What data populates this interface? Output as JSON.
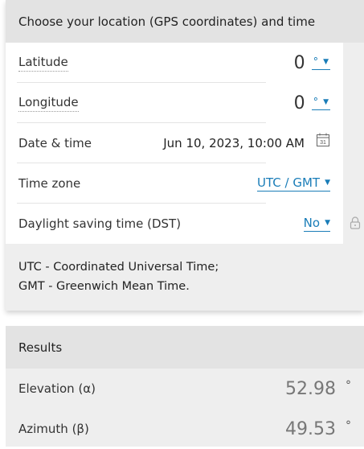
{
  "location": {
    "title": "Choose your location (GPS coordinates) and time",
    "latitude": {
      "label": "Latitude",
      "value": "0",
      "unit": "°"
    },
    "longitude": {
      "label": "Longitude",
      "value": "0",
      "unit": "°"
    },
    "datetime": {
      "label": "Date & time",
      "value": "Jun 10, 2023, 10:00 AM",
      "calendar_day": "31"
    },
    "timezone": {
      "label": "Time zone",
      "value": "UTC / GMT"
    },
    "dst": {
      "label": "Daylight saving time (DST)",
      "value": "No"
    },
    "note_line1": "UTC - Coordinated Universal Time;",
    "note_line2": "GMT - Greenwich Mean Time."
  },
  "results": {
    "title": "Results",
    "elevation": {
      "label": "Elevation (α)",
      "value": "52.98",
      "unit": "°"
    },
    "azimuth": {
      "label": "Azimuth (β)",
      "value": "49.53",
      "unit": "°"
    }
  },
  "colors": {
    "link": "#1a7db8",
    "header_bg": "#e3e3e3",
    "card_bg": "#eeeeee"
  },
  "icons": {
    "calendar": "calendar-icon",
    "lock": "lock-icon",
    "caret": "caret-down-icon"
  }
}
